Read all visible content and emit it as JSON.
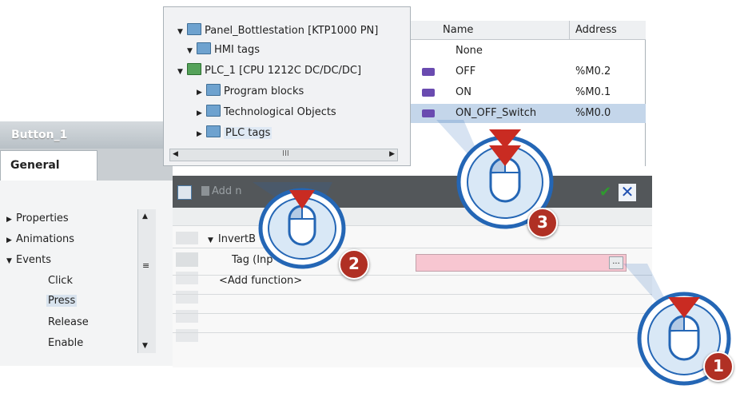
{
  "inspector": {
    "title": "Button_1",
    "tab": "General",
    "nav": [
      "Properties",
      "Animations",
      "Events",
      "Click",
      "Press",
      "Release",
      "Enable"
    ]
  },
  "tree": {
    "items": [
      {
        "label": "Panel_Bottlestation [KTP1000 PN]",
        "expanded": true
      },
      {
        "label": "HMI tags",
        "expanded": true
      },
      {
        "label": "PLC_1 [CPU 1212C DC/DC/DC]",
        "expanded": true
      },
      {
        "label": "Program blocks",
        "expanded": false
      },
      {
        "label": "Technological Objects",
        "expanded": false
      },
      {
        "label": "PLC tags",
        "expanded": false
      }
    ],
    "scroll_glyph": "III"
  },
  "tags": {
    "headers": {
      "name": "Name",
      "address": "Address"
    },
    "rows": [
      {
        "name": "None",
        "address": ""
      },
      {
        "name": "OFF",
        "address": "%M0.2"
      },
      {
        "name": "ON",
        "address": "%M0.1"
      },
      {
        "name": "ON_OFF_Switch",
        "address": "%M0.0"
      }
    ]
  },
  "editor": {
    "add_label": "Add n",
    "function_name": "InvertB",
    "param_label": "Tag (Inp",
    "add_function": "<Add function>",
    "field_btn": "..."
  },
  "callouts": [
    "1",
    "2",
    "3"
  ],
  "colors": {
    "accent_red": "#b03024",
    "selection": "#c4d6ea",
    "tag_field": "#f7c6d1"
  }
}
